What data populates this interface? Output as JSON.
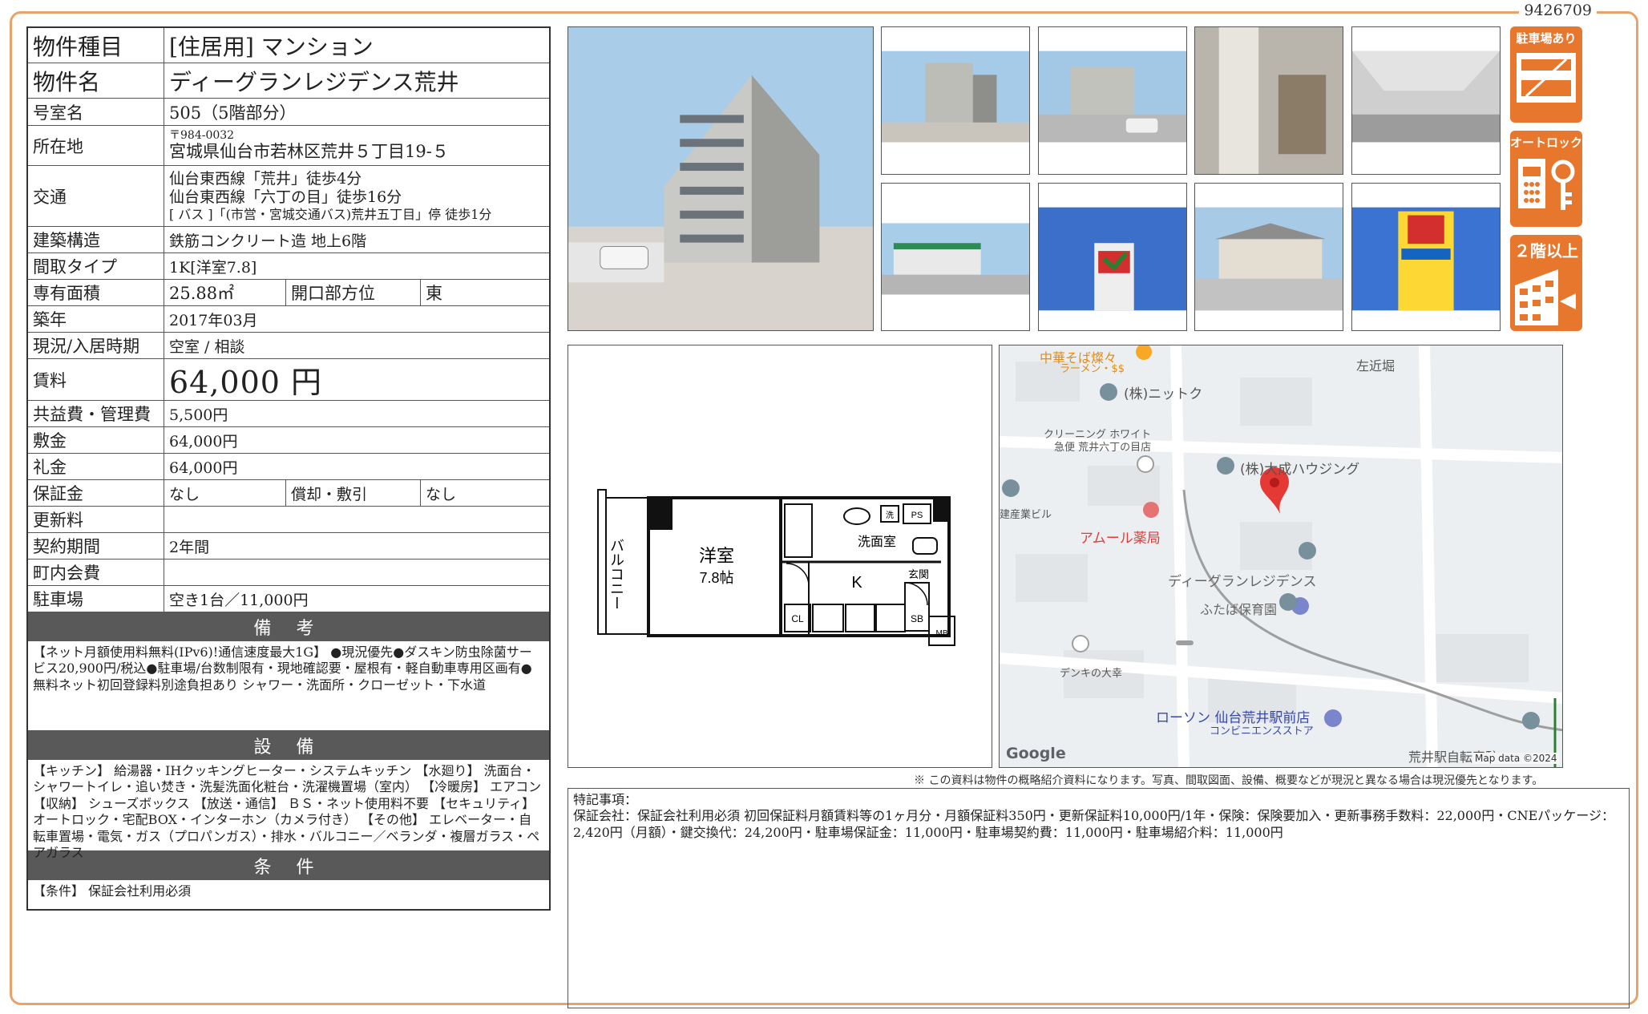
{
  "doc_id": "9426709",
  "info": {
    "type_label": "物件種目",
    "type_value": "[住居用] マンション",
    "name_label": "物件名",
    "name_value": "ディーグランレジデンス荒井",
    "room_label": "号室名",
    "room_value": "505（5階部分）",
    "address_label": "所在地",
    "address_postal": "〒984-0032",
    "address_value": "宮城県仙台市若林区荒井５丁目19-５",
    "traffic_label": "交通",
    "traffic_lines": [
      "仙台東西線「荒井」徒歩4分",
      "仙台東西線「六丁の目」徒歩16分",
      "[ バス ]「(市営・宮城交通バス)荒井五丁目」停 徒歩1分"
    ],
    "structure_label": "建築構造",
    "structure_value": "鉄筋コンクリート造 地上6階",
    "layout_label": "間取タイプ",
    "layout_value": "1K[洋室7.8]",
    "area_label": "専有面積",
    "area_value": "25.88㎡",
    "direction_label": "開口部方位",
    "direction_value": "東",
    "built_label": "築年",
    "built_value": "2017年03月",
    "status_label": "現況/入居時期",
    "status_value": "空室 / 相談",
    "rent_label": "賃料",
    "rent_value": "64,000 円",
    "common_label": "共益費・管理費",
    "common_value": "5,500円",
    "deposit_label": "敷金",
    "deposit_value": "64,000円",
    "key_money_label": "礼金",
    "key_money_value": "64,000円",
    "guarantee_label": "保証金",
    "guarantee_value": "なし",
    "amort_label": "償却・敷引",
    "amort_value": "なし",
    "renewal_label": "更新料",
    "renewal_value": "",
    "contract_label": "契約期間",
    "contract_value": "2年間",
    "town_fee_label": "町内会費",
    "town_fee_value": "",
    "parking_label": "駐車場",
    "parking_value": "空き1台／11,000円"
  },
  "remarks": {
    "title": "備 考",
    "text": "【ネット月額使用料無料(IPv6)!通信速度最大1G】 ●現況優先●ダスキン防虫除菌サービス20,900円/税込●駐車場/台数制限有・現地確認要・屋根有・軽自動車専用区画有●無料ネット初回登録料別途負担あり シャワー・洗面所・クローゼット・下水道"
  },
  "facilities": {
    "title": "設 備",
    "text": "【キッチン】 給湯器・IHクッキングヒーター・システムキッチン 【水廻り】 洗面台・シャワートイレ・追い焚き・洗髪洗面化粧台・洗濯機置場（室内） 【冷暖房】 エアコン 【収納】 シューズボックス 【放送・通信】 ＢＳ・ネット使用料不要 【セキュリティ】 オートロック・宅配BOX・インターホン（カメラ付き） 【その他】 エレベーター・自転車置場・電気・ガス（プロパンガス）・排水・バルコニー／ベランダ・複層ガラス・ペアガラス"
  },
  "conditions": {
    "title": "条 件",
    "text": "【条件】 保証会社利用必須"
  },
  "badges": {
    "parking": "駐車場あり",
    "autolock": "オートロック",
    "upper_floor": "２階以上"
  },
  "floor_plan": {
    "balcony": "バルコニー",
    "room": "洋室",
    "room_size": "7.8帖",
    "washroom": "洗面室",
    "kitchen": "K",
    "entrance": "玄関",
    "ps": "PS",
    "cl": "CL",
    "sb": "SB",
    "mb": "MB",
    "laundry": "洗"
  },
  "map": {
    "labels": {
      "ramen": "中華そば燦々",
      "ramen_sub": "ラーメン・$$",
      "left_bori": "左近堀",
      "nittoku": "(株)ニットク",
      "cleaning": "クリーニング ホワイト",
      "cleaning_sub": "急便 荒井六丁の目店",
      "taisei": "(株)大成ハウジング",
      "building": "建産業ビル",
      "pharmacy": "アムール薬局",
      "property": "ディーグランレジデンス",
      "nursery": "ふたば保育園",
      "denki": "デンキの大幸",
      "lawson": "ローソン 仙台荒井駅前店",
      "lawson_sub": "コンビニエンスストア",
      "station": "荒井駅自転車駐輪場",
      "google": "Google",
      "copyright": "Map data ©2024"
    }
  },
  "disclaimer": "※ この資料は物件の概略紹介資料になります。写真、間取図面、設備、概要などが現況と異なる場合は現況優先となります。",
  "notes": {
    "title": "特記事項：",
    "text": "保証会社：保証会社利用必須 初回保証料月額賃料等の1ヶ月分・月額保証料350円・更新保証料10,000円/1年・保険：保険要加入・更新事務手数料：22,000円・CNEパッケージ：2,420円（月額）・鍵交換代：24,200円・駐車場保証金：11,000円・駐車場契約費：11,000円・駐車場紹介料：11,000円"
  },
  "colors": {
    "accent_orange": "#e8772e",
    "frame": "#e8a36b",
    "section_gray": "#595959",
    "map_pin_red": "#e53935"
  }
}
